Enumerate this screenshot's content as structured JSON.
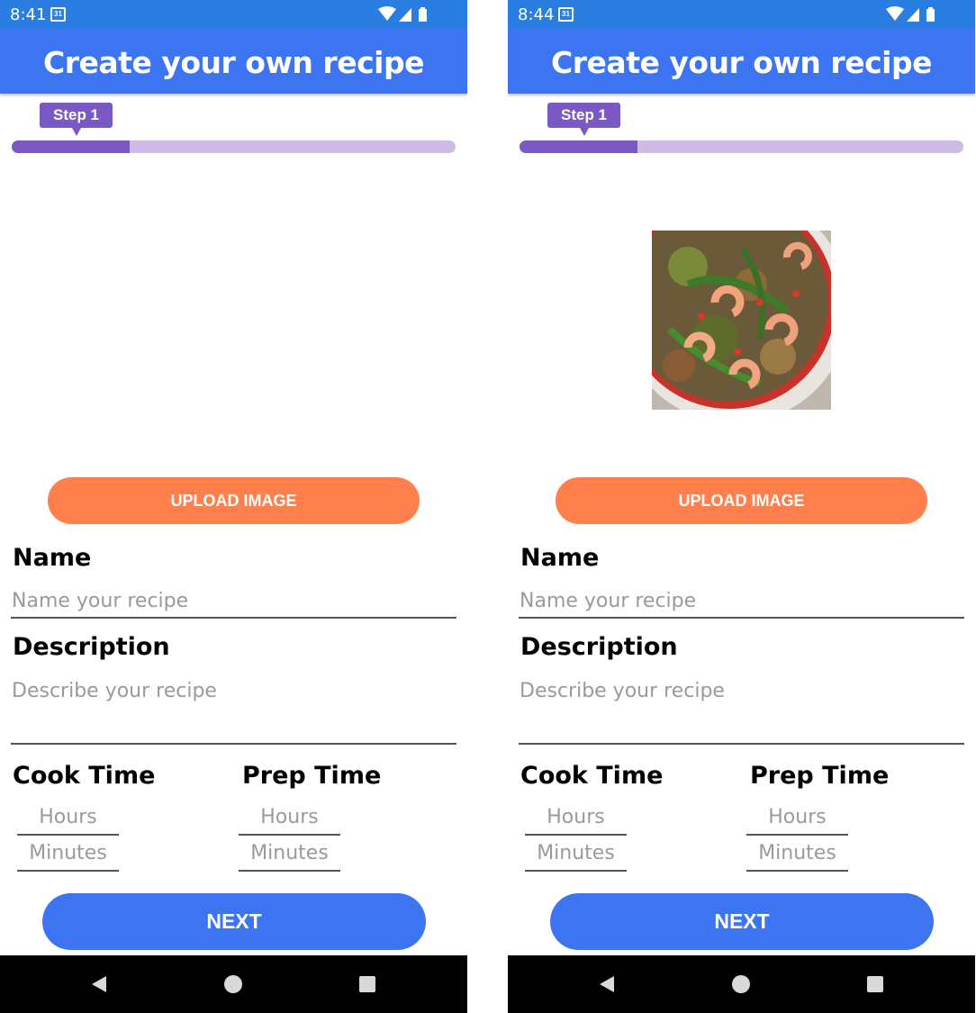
{
  "screens": [
    {
      "status": {
        "time": "8:41",
        "calendar_day": "31"
      },
      "app_title": "Create your own recipe",
      "step": {
        "label": "Step 1",
        "progress": 0.265
      },
      "has_image": false,
      "upload_label": "UPLOAD IMAGE",
      "name": {
        "label": "Name",
        "placeholder": "Name your recipe"
      },
      "description": {
        "label": "Description",
        "placeholder": "Describe your recipe"
      },
      "cook_time": {
        "label": "Cook Time",
        "hours_placeholder": "Hours",
        "minutes_placeholder": "Minutes"
      },
      "prep_time": {
        "label": "Prep Time",
        "hours_placeholder": "Hours",
        "minutes_placeholder": "Minutes"
      },
      "next_label": "NEXT"
    },
    {
      "status": {
        "time": "8:44",
        "calendar_day": "31"
      },
      "app_title": "Create your own recipe",
      "step": {
        "label": "Step 1",
        "progress": 0.265
      },
      "has_image": true,
      "upload_label": "UPLOAD IMAGE",
      "name": {
        "label": "Name",
        "placeholder": "Name your recipe"
      },
      "description": {
        "label": "Description",
        "placeholder": "Describe your recipe"
      },
      "cook_time": {
        "label": "Cook Time",
        "hours_placeholder": "Hours",
        "minutes_placeholder": "Minutes"
      },
      "prep_time": {
        "label": "Prep Time",
        "hours_placeholder": "Hours",
        "minutes_placeholder": "Minutes"
      },
      "next_label": "NEXT"
    }
  ],
  "colors": {
    "status_bar": "#2a7ee2",
    "app_bar": "#3d74f2",
    "step_accent": "#7b59c4",
    "progress_track": "#cdbde6",
    "upload_button": "#ff7f4d",
    "next_button": "#3d74f2"
  },
  "icons": [
    "calendar-icon",
    "wifi-icon",
    "cellular-signal-icon",
    "battery-icon",
    "nav-back-icon",
    "nav-home-icon",
    "nav-recents-icon"
  ]
}
